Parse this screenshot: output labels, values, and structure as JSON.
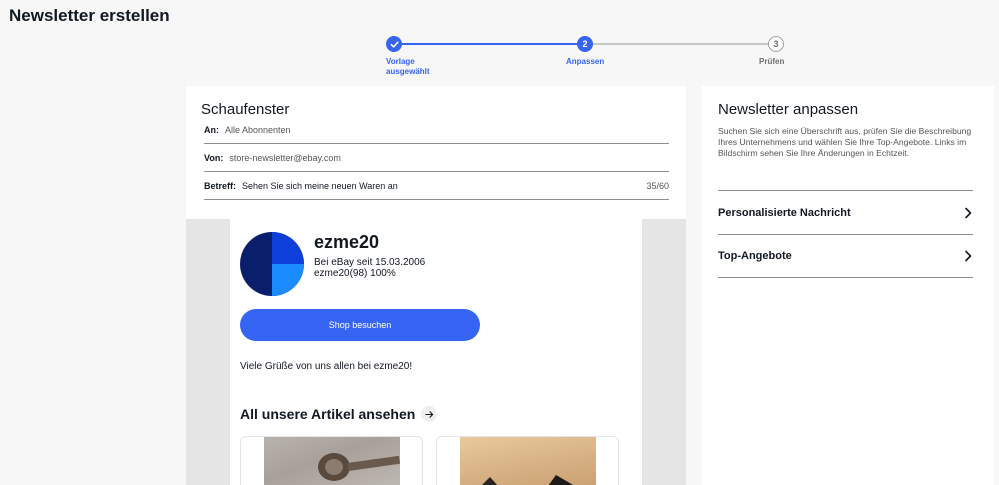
{
  "page": {
    "title": "Newsletter erstellen"
  },
  "stepper": {
    "steps": [
      {
        "label": "Vorlage ausgewählt",
        "number": "1",
        "state": "done"
      },
      {
        "label": "Anpassen",
        "number": "2",
        "state": "active"
      },
      {
        "label": "Prüfen",
        "number": "3",
        "state": "todo"
      }
    ]
  },
  "editor": {
    "title": "Schaufenster",
    "to_label": "An:",
    "to_value": "Alle Abonnenten",
    "from_label": "Von:",
    "from_value": "store-newsletter@ebay.com",
    "subject_label": "Betreff:",
    "subject_value": "Sehen Sie sich meine neuen Waren an",
    "subject_count": "35/60"
  },
  "preview": {
    "shop_name": "ezme20",
    "member_since": "Bei eBay seit 15.03.2006",
    "feedback_user": "ezme20(98)",
    "feedback_pct": "100%",
    "visit_button": "Shop besuchen",
    "greeting": "Viele Grüße von uns allen bei ezme20!",
    "all_items_label": "All unsere Artikel ansehen",
    "colors": {
      "accent": "#3665f3",
      "pie_dark": "#0a1f6b",
      "pie_blue": "#0f3fd9",
      "pie_light": "#1a8cff"
    }
  },
  "sidebar": {
    "title": "Newsletter anpassen",
    "description": "Suchen Sie sich eine Überschrift aus, prüfen Sie die Beschreibung Ihres Unternehmens und wählen Sie Ihre Top-Angebote. Links im Bildschirm sehen Sie Ihre Änderungen in Echtzeit.",
    "items": [
      {
        "label": "Personalisierte Nachricht"
      },
      {
        "label": "Top-Angebote"
      }
    ]
  }
}
